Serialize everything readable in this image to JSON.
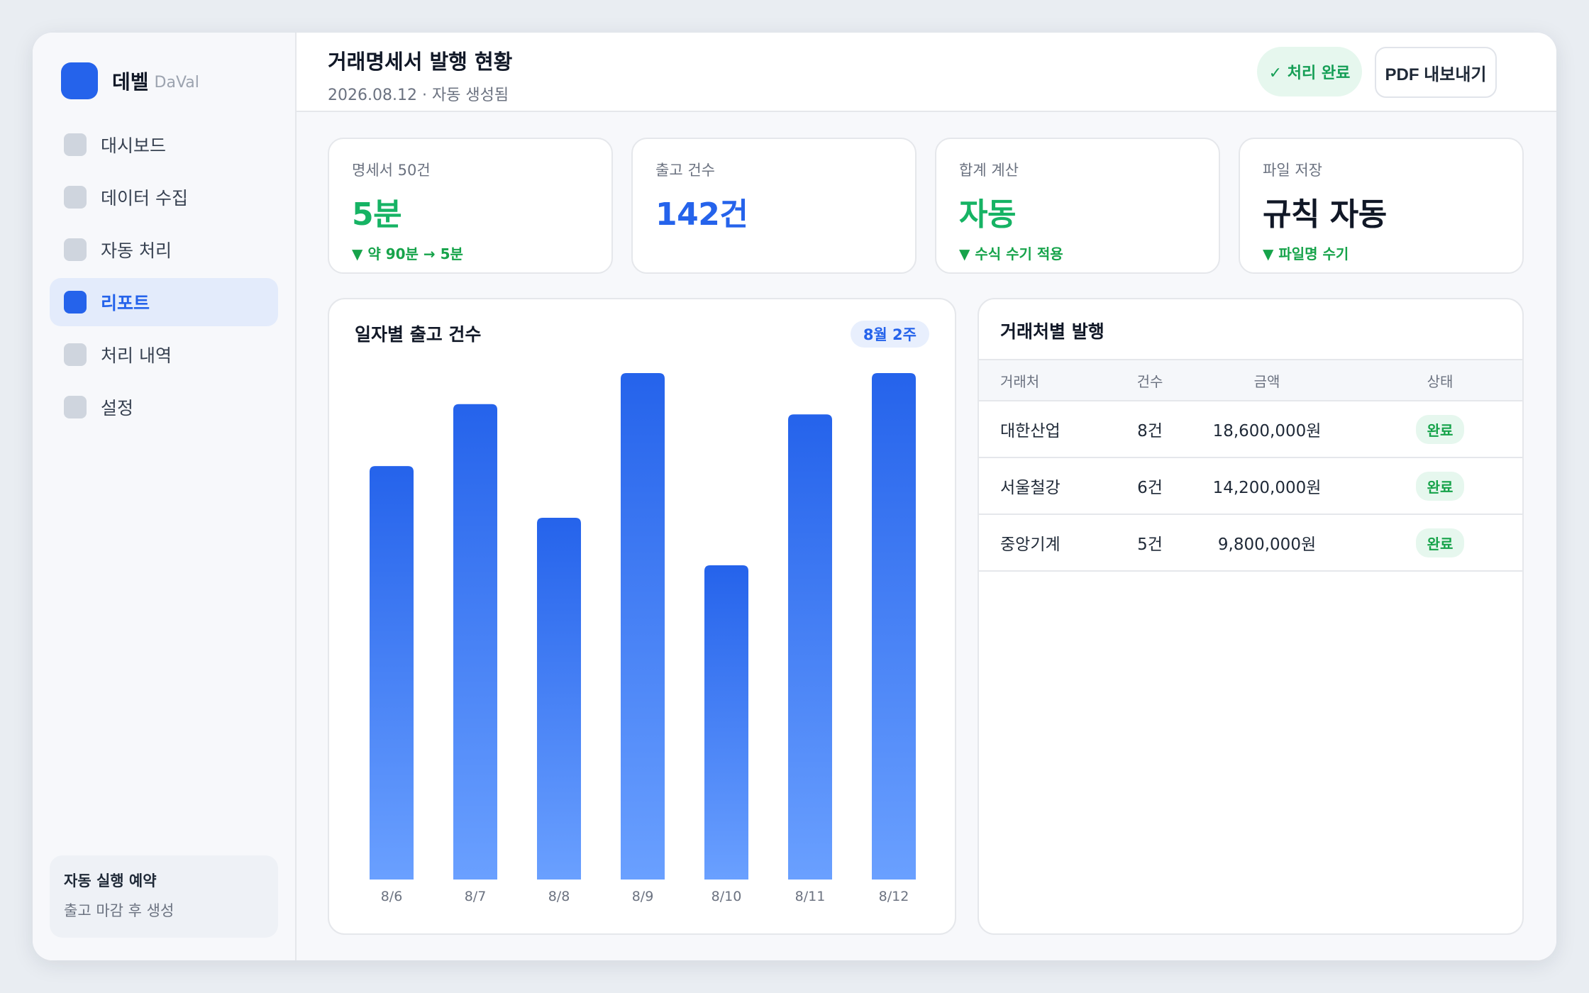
{
  "brand": {
    "name": "데벨",
    "sub": "DaVal"
  },
  "sidebar": {
    "items": [
      {
        "label": "대시보드",
        "active": false
      },
      {
        "label": "데이터 수집",
        "active": false
      },
      {
        "label": "자동 처리",
        "active": false
      },
      {
        "label": "리포트",
        "active": true
      },
      {
        "label": "처리 내역",
        "active": false
      },
      {
        "label": "설정",
        "active": false
      }
    ],
    "schedule": {
      "title": "자동 실행 예약",
      "sub": "출고 마감 후 생성"
    }
  },
  "header": {
    "title": "거래명세서 발행 현황",
    "subtitle": "2026.08.12 · 자동 생성됨",
    "status": "✓ 처리 완료",
    "export_label": "PDF 내보내기"
  },
  "stats": [
    {
      "label": "명세서 50건",
      "value": "5분",
      "delta": "▼ 약 90분 → 5분",
      "color": "#16b364"
    },
    {
      "label": "출고 건수",
      "value": "142건",
      "delta": "",
      "color": "#2563eb"
    },
    {
      "label": "합계 계산",
      "value": "자동",
      "delta": "▼ 수식 수기 적용",
      "color": "#16b364"
    },
    {
      "label": "파일 저장",
      "value": "규칙 자동",
      "delta": "▼ 파일명 수기",
      "color": "#111827"
    }
  ],
  "chart": {
    "title": "일자별 출고 건수",
    "badge": "8월 2주"
  },
  "chart_data": {
    "type": "bar",
    "categories": [
      "8/6",
      "8/7",
      "8/8",
      "8/9",
      "8/10",
      "8/11",
      "8/12"
    ],
    "values": [
      20,
      23,
      17.5,
      24.5,
      15.2,
      22.5,
      24.5
    ],
    "ylim": [
      0,
      24.5
    ],
    "grid": false,
    "colors": {
      "top": "#2563eb",
      "bottom": "#6aa0ff"
    }
  },
  "table": {
    "title": "거래처별 발행",
    "headers": [
      "거래처",
      "건수",
      "금액",
      "상태"
    ],
    "rows": [
      {
        "name": "대한산업",
        "count": "8건",
        "amount": "18,600,000원",
        "status": "완료"
      },
      {
        "name": "서울철강",
        "count": "6건",
        "amount": "14,200,000원",
        "status": "완료"
      },
      {
        "name": "중앙기계",
        "count": "5건",
        "amount": "9,800,000원",
        "status": "완료"
      }
    ]
  }
}
